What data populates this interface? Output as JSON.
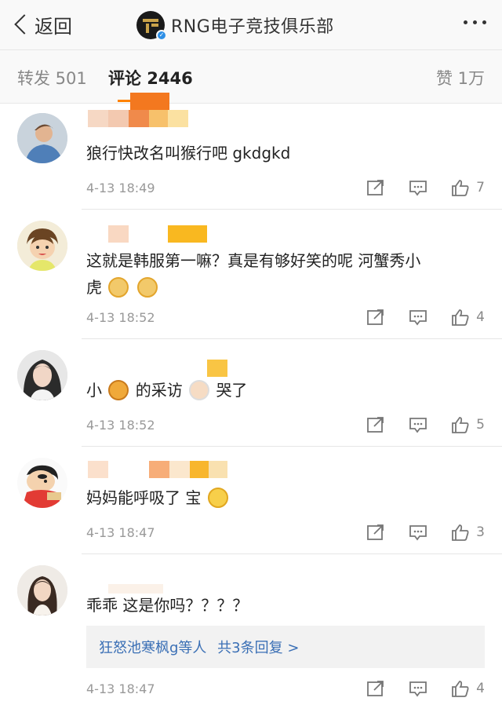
{
  "nav": {
    "back_label": "返回",
    "title": "RNG电子竞技俱乐部"
  },
  "tabs": {
    "repost": "转发 501",
    "comments": "评论 2446",
    "likes": "赞 1万"
  },
  "comments": [
    {
      "text": "狼行快改名叫猴行吧 gkdgkd",
      "time": "4-13 18:49",
      "likes": "7"
    },
    {
      "text_part1": "这就是韩服第一嘛？真是有够好笑的呢 河蟹秀小",
      "text_part2": "虎",
      "time": "4-13 18:52",
      "likes": "4"
    },
    {
      "text_part1": "小",
      "text_part2": "的采访",
      "text_part3": "哭了",
      "time": "4-13 18:52",
      "likes": "5"
    },
    {
      "text": "妈妈能呼吸了 宝",
      "time": "4-13 18:47",
      "likes": "3"
    },
    {
      "text": "乖乖 这是你吗？？？？",
      "time": "4-13 18:47",
      "likes": "4",
      "replies_text": "狂怒池寒枫g等人",
      "replies_link": "共3条回复 >"
    }
  ],
  "colors": {
    "accent": "#ff8200",
    "link": "#3a6fb5",
    "meta": "#999999"
  },
  "icons": [
    "back-chevron-icon",
    "verified-badge-icon",
    "more-icon",
    "repost-icon",
    "comment-icon",
    "like-icon"
  ]
}
